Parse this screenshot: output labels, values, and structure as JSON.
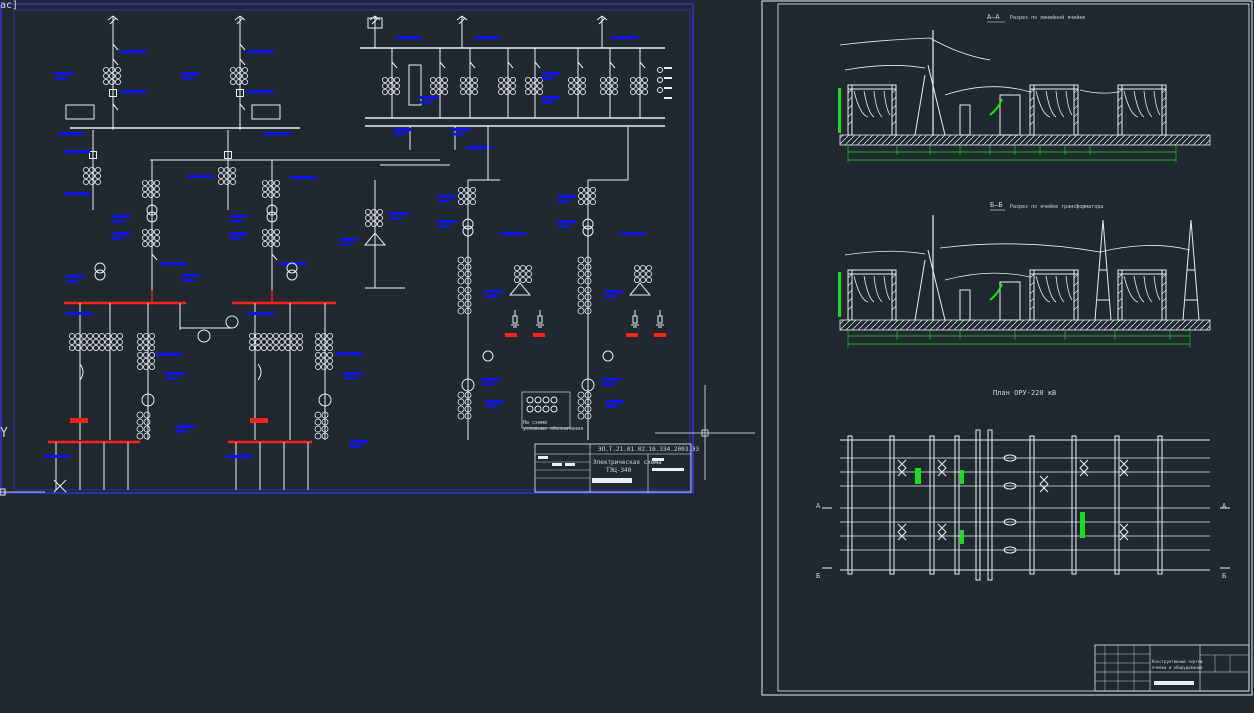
{
  "viewport_tag": "ас]",
  "sheet1": {
    "stamp_code": "ЭЛ.Т.21.01.02.1б.334.2003.ЭЗ",
    "stamp_title": "Электрическая схема",
    "stamp_subtitle": "ТЭЦ-340",
    "legend_note_1": "На схеме",
    "legend_note_2": "условные обозначения"
  },
  "sheet2": {
    "section_a_title": "А–А",
    "section_a_note": "Разрез по линейной ячейке",
    "section_b_title": "Б–Б",
    "section_b_note": "Разрез по ячейке трансформатора",
    "plan_title": "План ОРУ-220 кВ",
    "section_mark_a": "А",
    "section_mark_b": "Б",
    "stamp_title_1": "Конструктивный чертеж",
    "stamp_title_2": "ячейки и оборудования"
  },
  "ucs": {
    "y_axis": "Y",
    "x_axis": "X"
  },
  "colors": {
    "background": "#212830",
    "line": "#e8eef2",
    "annotation": "#1010ff",
    "accent": "#ff2020",
    "dimension": "#18e018"
  }
}
